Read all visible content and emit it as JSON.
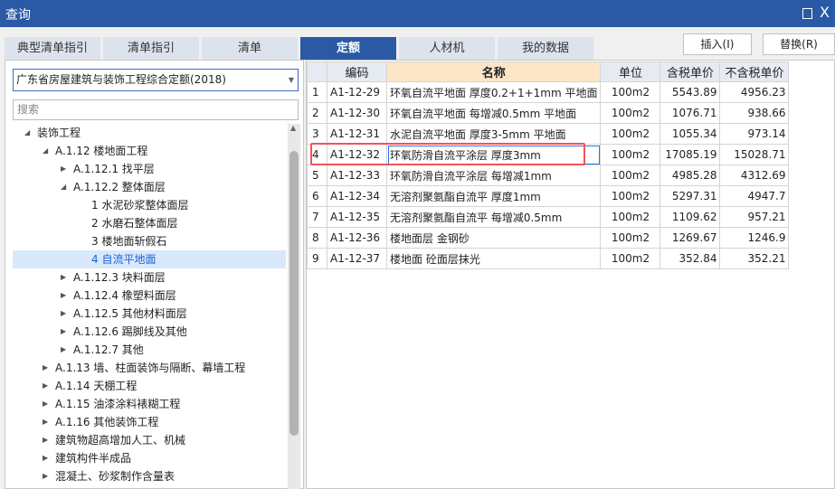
{
  "window": {
    "title": "查询",
    "max_icon": "maximize-icon",
    "close_icon": "close-icon",
    "close_glyph": "X"
  },
  "tabs": [
    {
      "label": "典型清单指引"
    },
    {
      "label": "清单指引"
    },
    {
      "label": "清单"
    },
    {
      "label": "定额",
      "active": true
    },
    {
      "label": "人材机"
    },
    {
      "label": "我的数据"
    }
  ],
  "buttons": {
    "insert": "插入(I)",
    "replace": "替换(R)"
  },
  "left": {
    "library": "广东省房屋建筑与装饰工程综合定额(2018)",
    "search_placeholder": "搜索",
    "tree": [
      {
        "label": "装饰工程",
        "level": 0,
        "state": "open"
      },
      {
        "label": "A.1.12 楼地面工程",
        "level": 1,
        "state": "open"
      },
      {
        "label": "A.1.12.1 找平层",
        "level": 2,
        "state": "closed"
      },
      {
        "label": "A.1.12.2 整体面层",
        "level": 2,
        "state": "open"
      },
      {
        "label": "1 水泥砂浆整体面层",
        "level": 3
      },
      {
        "label": "2 水磨石整体面层",
        "level": 3
      },
      {
        "label": "3 楼地面斩假石",
        "level": 3
      },
      {
        "label": "4 自流平地面",
        "level": 3,
        "selected": true
      },
      {
        "label": "A.1.12.3 块料面层",
        "level": 2,
        "state": "closed"
      },
      {
        "label": "A.1.12.4 橡塑料面层",
        "level": 2,
        "state": "closed"
      },
      {
        "label": "A.1.12.5 其他材料面层",
        "level": 2,
        "state": "closed"
      },
      {
        "label": "A.1.12.6 踢脚线及其他",
        "level": 2,
        "state": "closed"
      },
      {
        "label": "A.1.12.7 其他",
        "level": 2,
        "state": "closed"
      },
      {
        "label": "A.1.13 墙、柱面装饰与隔断、幕墙工程",
        "level": 1,
        "state": "closed"
      },
      {
        "label": "A.1.14 天棚工程",
        "level": 1,
        "state": "closed"
      },
      {
        "label": "A.1.15 油漆涂料裱糊工程",
        "level": 1,
        "state": "closed"
      },
      {
        "label": "A.1.16 其他装饰工程",
        "level": 1,
        "state": "closed"
      },
      {
        "label": "建筑物超高增加人工、机械",
        "level": 1,
        "state": "closed"
      },
      {
        "label": "建筑构件半成品",
        "level": 1,
        "state": "closed"
      },
      {
        "label": "混凝土、砂浆制作含量表",
        "level": 1,
        "state": "closed"
      }
    ]
  },
  "table": {
    "headers": [
      "",
      "编码",
      "名称",
      "单位",
      "含税单价",
      "不含税单价"
    ],
    "rows": [
      [
        "1",
        "A1-12-29",
        "环氧自流平地面 厚度0.2+1+1mm 平地面",
        "100m2",
        "5543.89",
        "4956.23"
      ],
      [
        "2",
        "A1-12-30",
        "环氧自流平地面 每增减0.5mm 平地面",
        "100m2",
        "1076.71",
        "938.66"
      ],
      [
        "3",
        "A1-12-31",
        "水泥自流平地面 厚度3-5mm 平地面",
        "100m2",
        "1055.34",
        "973.14"
      ],
      [
        "4",
        "A1-12-32",
        "环氧防滑自流平涂层 厚度3mm",
        "100m2",
        "17085.19",
        "15028.71"
      ],
      [
        "5",
        "A1-12-33",
        "环氧防滑自流平涂层 每增减1mm",
        "100m2",
        "4985.28",
        "4312.69"
      ],
      [
        "6",
        "A1-12-34",
        "无溶剂聚氨酯自流平 厚度1mm",
        "100m2",
        "5297.31",
        "4947.7"
      ],
      [
        "7",
        "A1-12-35",
        "无溶剂聚氨酯自流平 每增减0.5mm",
        "100m2",
        "1109.62",
        "957.21"
      ],
      [
        "8",
        "A1-12-36",
        "楼地面层 金钢砂",
        "100m2",
        "1269.67",
        "1246.9"
      ],
      [
        "9",
        "A1-12-37",
        "楼地面 砼面层抹光",
        "100m2",
        "352.84",
        "352.21"
      ]
    ],
    "selected_row": 4
  }
}
